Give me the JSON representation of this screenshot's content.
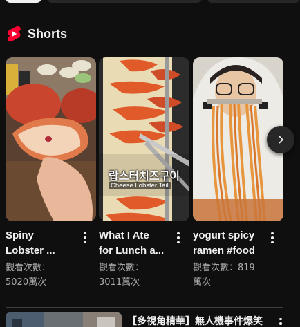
{
  "shelf": {
    "title": "Shorts",
    "logo_icon": "youtube-shorts-icon",
    "accent": "#ff0033"
  },
  "cards": [
    {
      "title_lines": [
        "Spiny",
        "Lobster ..."
      ],
      "views_lines": [
        "觀看次數：",
        "5020萬次"
      ]
    },
    {
      "title_lines": [
        "What I Ate",
        "for Lunch a..."
      ],
      "views_lines": [
        "觀看次數：",
        "3011萬次"
      ],
      "overlay_title": "랍스터치즈구이",
      "overlay_sub": "Cheese Lobster Tail"
    },
    {
      "title_lines": [
        "yogurt spicy",
        "ramen #food"
      ],
      "views_lines": [
        "觀看次數：819",
        "萬次"
      ]
    }
  ],
  "next_button_icon": "chevron-right-icon",
  "more_icon": "more-vert-icon",
  "video": {
    "title": "【多視角精華】無人機事件爆笑"
  }
}
